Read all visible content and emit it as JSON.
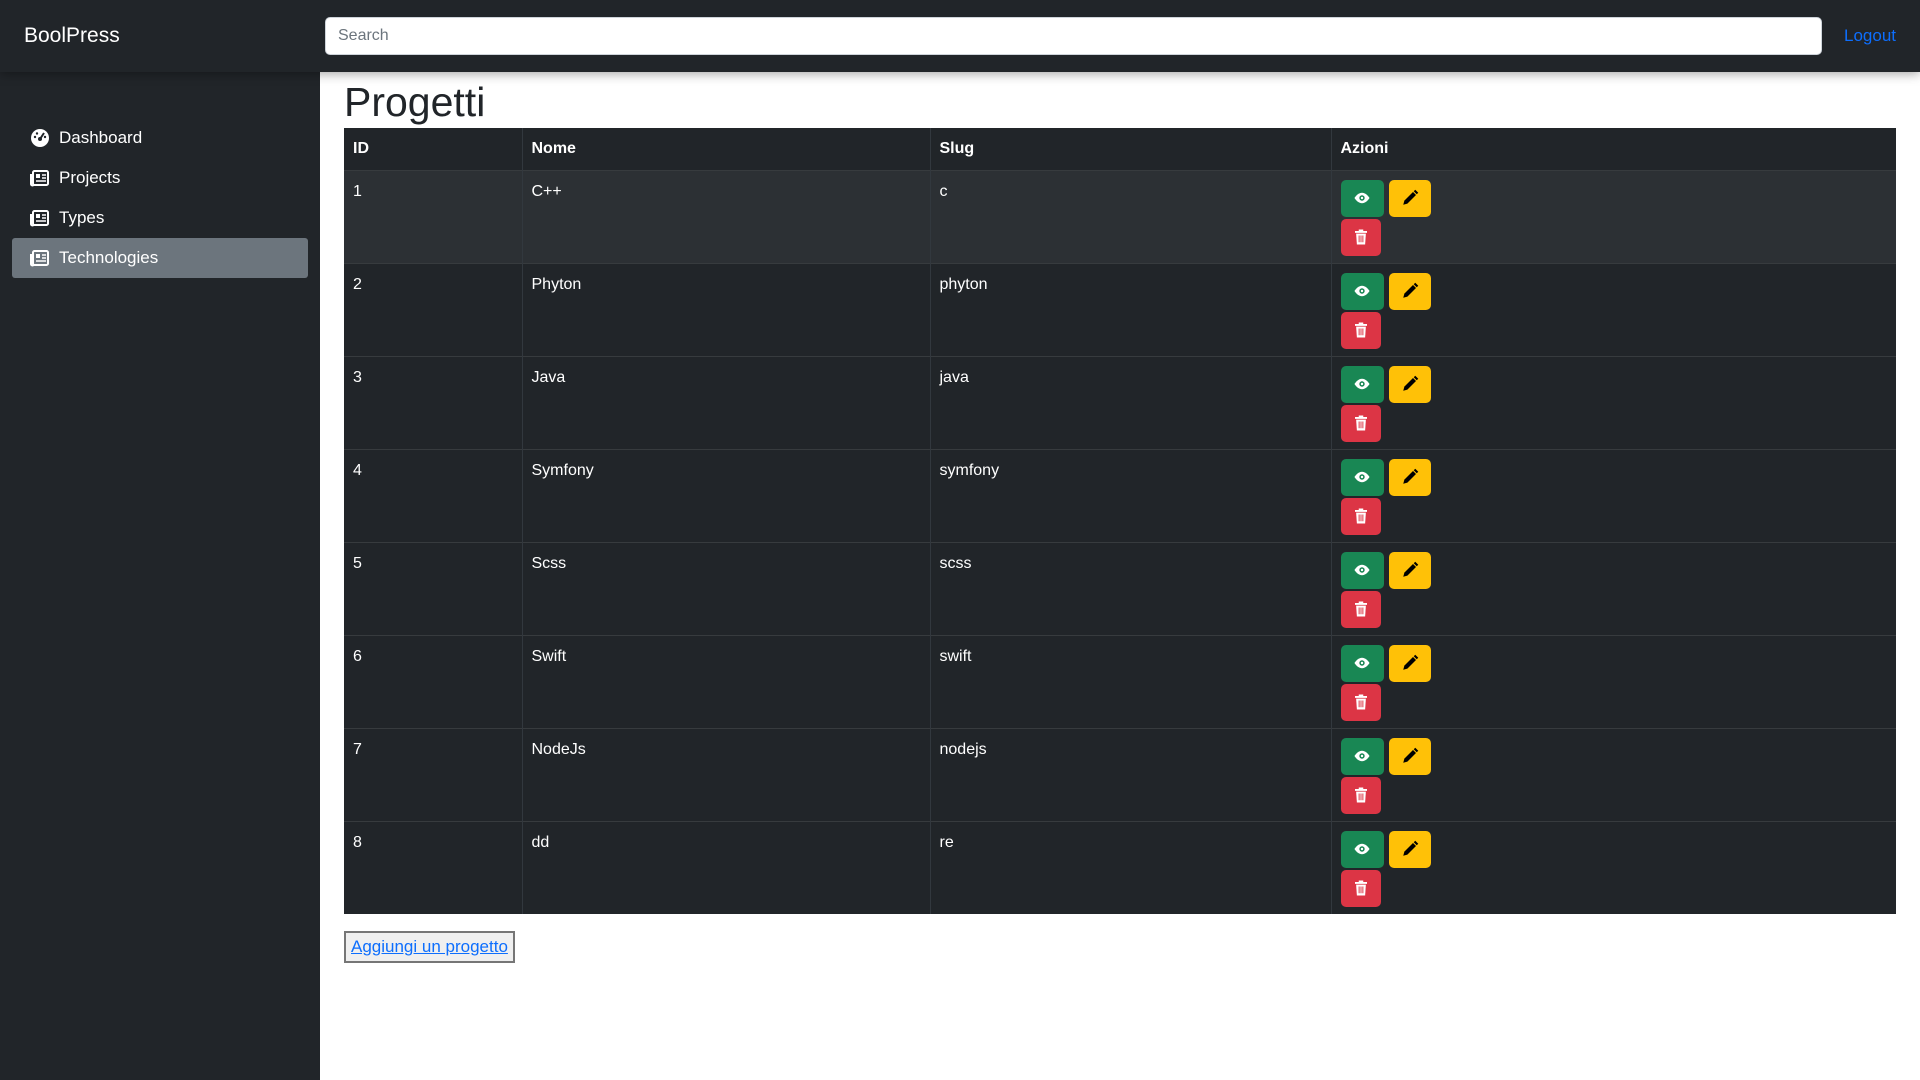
{
  "navbar": {
    "brand": "BoolPress",
    "search_placeholder": "Search",
    "logout_label": "Logout"
  },
  "sidebar": {
    "items": [
      {
        "label": "Dashboard",
        "icon": "dashboard-gauge-icon",
        "active": false
      },
      {
        "label": "Projects",
        "icon": "newspaper-icon",
        "active": false
      },
      {
        "label": "Types",
        "icon": "newspaper-icon",
        "active": false
      },
      {
        "label": "Technologies",
        "icon": "newspaper-icon",
        "active": true
      }
    ]
  },
  "main": {
    "title": "Progetti",
    "table": {
      "headers": [
        "ID",
        "Nome",
        "Slug",
        "Azioni"
      ],
      "rows": [
        {
          "id": "1",
          "nome": "C++",
          "slug": "c"
        },
        {
          "id": "2",
          "nome": "Phyton",
          "slug": "phyton"
        },
        {
          "id": "3",
          "nome": "Java",
          "slug": "java"
        },
        {
          "id": "4",
          "nome": "Symfony",
          "slug": "symfony"
        },
        {
          "id": "5",
          "nome": "Scss",
          "slug": "scss"
        },
        {
          "id": "6",
          "nome": "Swift",
          "slug": "swift"
        },
        {
          "id": "7",
          "nome": "NodeJs",
          "slug": "nodejs"
        },
        {
          "id": "8",
          "nome": "dd",
          "slug": "re"
        }
      ]
    },
    "add_button_label": "Aggiungi un progetto"
  },
  "colors": {
    "dark": "#212529",
    "active_nav": "#6c757d",
    "view_button": "#198754",
    "edit_button": "#ffc107",
    "delete_button": "#dc3545",
    "link": "#0d6efd"
  }
}
